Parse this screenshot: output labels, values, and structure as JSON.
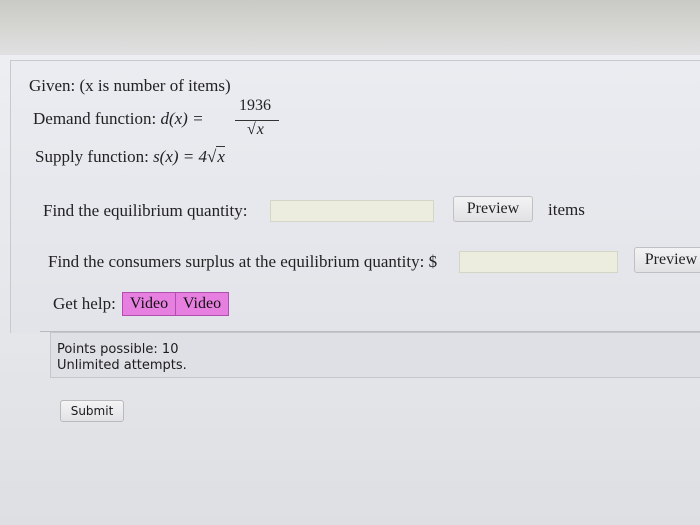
{
  "question": {
    "given": "Given: (x is number of items)",
    "demand_label": "Demand function:",
    "demand_lhs": "d(x) =",
    "demand_numerator": "1936",
    "demand_denominator_var": "x",
    "supply_label": "Supply function:",
    "supply_lhs": "s(x) = 4",
    "supply_var": "x"
  },
  "part1": {
    "prompt": "Find the equilibrium quantity:",
    "input_value": "",
    "preview_label": "Preview",
    "units": "items"
  },
  "part2": {
    "prompt": "Find the consumers surplus at the equilibrium quantity: $",
    "input_value": "",
    "preview_label": "Preview"
  },
  "help": {
    "label": "Get help:",
    "video1": "Video",
    "video2": "Video"
  },
  "info": {
    "points": "Points possible: 10",
    "attempts": "Unlimited attempts."
  },
  "submit_label": "Submit",
  "colors": {
    "help_button": "#e77fe0",
    "input_bg": "#ececdf"
  }
}
